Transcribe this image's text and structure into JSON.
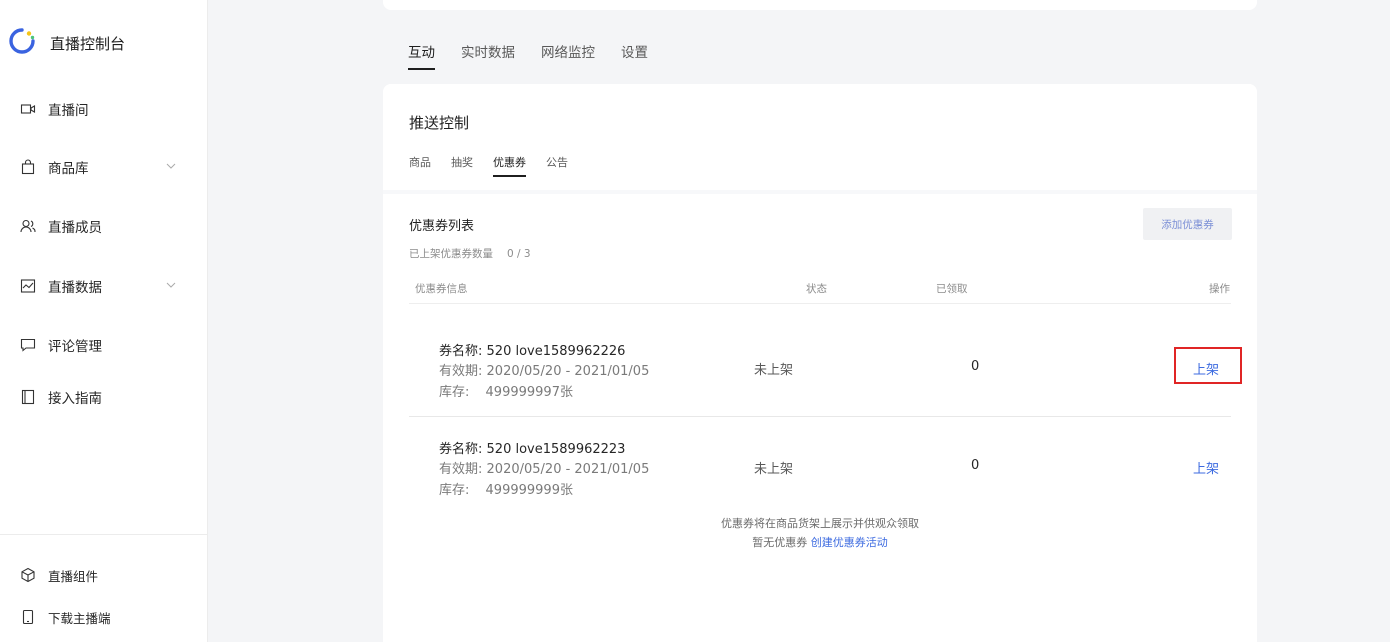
{
  "sidebar": {
    "brand_title": "直播控制台",
    "items": [
      {
        "label": "直播间",
        "icon": "video-icon"
      },
      {
        "label": "商品库",
        "icon": "shopping-bag-icon",
        "expandable": true
      },
      {
        "label": "直播成员",
        "icon": "members-icon"
      },
      {
        "label": "直播数据",
        "icon": "chart-icon",
        "expandable": true
      },
      {
        "label": "评论管理",
        "icon": "comment-icon"
      },
      {
        "label": "接入指南",
        "icon": "book-icon"
      }
    ],
    "bottom_items": [
      {
        "label": "直播组件",
        "icon": "cube-icon"
      },
      {
        "label": "下载主播端",
        "icon": "phone-icon"
      }
    ]
  },
  "main_tabs": [
    {
      "label": "互动",
      "active": true
    },
    {
      "label": "实时数据",
      "active": false
    },
    {
      "label": "网络监控",
      "active": false
    },
    {
      "label": "设置",
      "active": false
    }
  ],
  "push_control": {
    "title": "推送控制",
    "sub_tabs": [
      {
        "label": "商品",
        "active": false
      },
      {
        "label": "抽奖",
        "active": false
      },
      {
        "label": "优惠券",
        "active": true
      },
      {
        "label": "公告",
        "active": false
      }
    ]
  },
  "coupon_list": {
    "title": "优惠券列表",
    "count_label": "已上架优惠券数量",
    "count_value": "0 / 3",
    "add_button": "添加优惠券",
    "columns": {
      "info": "优惠券信息",
      "status": "状态",
      "claimed": "已领取",
      "action": "操作"
    },
    "rows": [
      {
        "name_label": "券名称:",
        "name_value": "520 love1589962226",
        "validity_label": "有效期:",
        "validity_value": "2020/05/20 - 2021/01/05",
        "stock_label": "库存:",
        "stock_value": "499999997张",
        "status": "未上架",
        "claimed": "0",
        "action": "上架",
        "highlighted": true
      },
      {
        "name_label": "券名称:",
        "name_value": "520 love1589962223",
        "validity_label": "有效期:",
        "validity_value": "2020/05/20 - 2021/01/05",
        "stock_label": "库存:",
        "stock_value": "499999999张",
        "status": "未上架",
        "claimed": "0",
        "action": "上架",
        "highlighted": false
      }
    ],
    "footer_note": "优惠券将在商品货架上展示并供观众领取",
    "empty_text": "暂无优惠券",
    "create_link": "创建优惠券活动"
  },
  "colors": {
    "accent": "#3d6be0",
    "highlight": "#e02525",
    "background": "#f4f5f7"
  }
}
